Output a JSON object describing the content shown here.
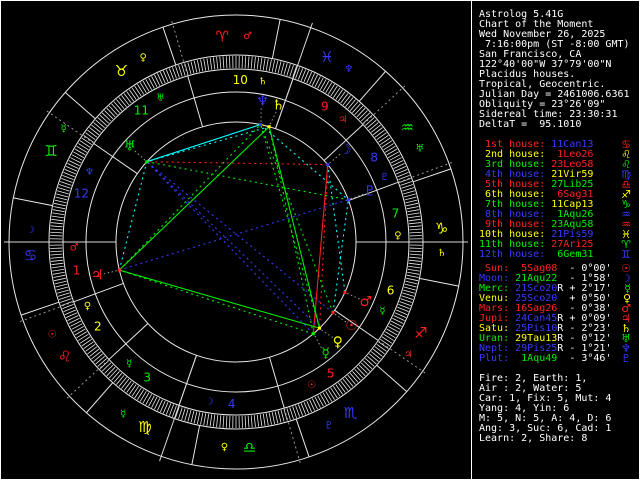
{
  "app": {
    "title_lines": [
      "Astrolog 5.41G",
      "Chart of the Moment",
      "Wed November 26, 2025",
      " 7:16:00pm (ST -8:00 GMT)",
      "San Francisco, CA",
      "122°40'00\"W 37°79'00\"N",
      "Placidus houses.",
      "Tropical, Geocentric.",
      "Julian Day = 2461006.6361",
      "Obliquity = 23°26'09\"",
      "Sidereal time: 23:30:31",
      "DeltaT =  95.1010"
    ]
  },
  "houses": [
    {
      "label": " 1st house:",
      "value": "11Can13",
      "sign": "Can"
    },
    {
      "label": " 2nd house:",
      "value": " 1Leo26",
      "sign": "Leo"
    },
    {
      "label": " 3rd house:",
      "value": "23Leo58",
      "sign": "Leo"
    },
    {
      "label": " 4th house:",
      "value": "21Vir59",
      "sign": "Vir"
    },
    {
      "label": " 5th house:",
      "value": "27Lib25",
      "sign": "Lib"
    },
    {
      "label": " 6th house:",
      "value": " 6Sag31",
      "sign": "Sag"
    },
    {
      "label": " 7th house:",
      "value": "11Cap13",
      "sign": "Cap"
    },
    {
      "label": " 8th house:",
      "value": " 1Aqu26",
      "sign": "Aqu"
    },
    {
      "label": " 9th house:",
      "value": "23Aqu58",
      "sign": "Aqu"
    },
    {
      "label": "10th house:",
      "value": "21Pis59",
      "sign": "Pis"
    },
    {
      "label": "11th house:",
      "value": "27Ari25",
      "sign": "Ari"
    },
    {
      "label": "12th house:",
      "value": " 6Gem31",
      "sign": "Gem"
    }
  ],
  "planets": [
    {
      "name": "Sun",
      "label": " Sun:",
      "value": " 5Sag08",
      "sign": "Sag",
      "retro": " ",
      "delta": "- 0°00'",
      "lon": 245.133
    },
    {
      "name": "Moon",
      "label": "Moon:",
      "value": "21Aqu22",
      "sign": "Aqu",
      "retro": " ",
      "delta": "- 1°58'",
      "lon": 321.367
    },
    {
      "name": "Mercury",
      "label": "Merc:",
      "value": "21Sco20",
      "sign": "Sco",
      "retro": "R",
      "delta": "+ 2°17'",
      "lon": 231.333
    },
    {
      "name": "Venus",
      "label": "Venu:",
      "value": "25Sco20",
      "sign": "Sco",
      "retro": " ",
      "delta": "+ 0°50'",
      "lon": 235.333
    },
    {
      "name": "Mars",
      "label": "Mars:",
      "value": "16Sag26",
      "sign": "Sag",
      "retro": " ",
      "delta": "- 0°38'",
      "lon": 256.433
    },
    {
      "name": "Jupiter",
      "label": "Jupi:",
      "value": "24Can45",
      "sign": "Can",
      "retro": "R",
      "delta": "+ 0°09'",
      "lon": 114.75
    },
    {
      "name": "Saturn",
      "label": "Satu:",
      "value": "25Pis10",
      "sign": "Pis",
      "retro": "R",
      "delta": "- 2°23'",
      "lon": 355.167
    },
    {
      "name": "Uranus",
      "label": "Uran:",
      "value": "29Tau13",
      "sign": "Tau",
      "retro": "R",
      "delta": "- 0°12'",
      "lon": 59.217
    },
    {
      "name": "Neptune",
      "label": "Nept:",
      "value": "29Pis25",
      "sign": "Pis",
      "retro": "R",
      "delta": "- 1°21'",
      "lon": 359.417
    },
    {
      "name": "Pluto",
      "label": "Plut:",
      "value": " 1Aqu49",
      "sign": "Aqu",
      "retro": " ",
      "delta": "- 3°46'",
      "lon": 301.817
    }
  ],
  "summary_lines": [
    "Fire: 2, Earth: 1,",
    "Air : 2, Water: 5",
    "Car: 1, Fix: 5, Mut: 4",
    "Yang: 4, Yin: 6",
    "M: 5, N: 5, A: 4, D: 6",
    "Ang: 3, Suc: 6, Cad: 1",
    "Learn: 2, Share: 8"
  ],
  "wheel": {
    "asc": 101.217,
    "cusps": [
      101.217,
      121.433,
      143.967,
      171.983,
      207.417,
      246.517,
      281.217,
      301.433,
      323.967,
      351.983,
      27.417,
      66.517
    ],
    "sign_order": [
      "Ari",
      "Tau",
      "Gem",
      "Can",
      "Leo",
      "Vir",
      "Lib",
      "Sco",
      "Sag",
      "Cap",
      "Aqu",
      "Pis"
    ],
    "house_rulers": [
      "Mars",
      "Venus",
      "Mercury",
      "Moon",
      "Sun",
      "Mercury",
      "Venus",
      "Pluto",
      "Jupiter",
      "Saturn",
      "Uranus",
      "Neptune"
    ]
  },
  "glyphs": {
    "Ari": "♈",
    "Tau": "♉",
    "Gem": "♊",
    "Can": "♋",
    "Leo": "♌",
    "Vir": "♍",
    "Lib": "♎",
    "Sco": "♏",
    "Sag": "♐",
    "Cap": "♑",
    "Aqu": "♒",
    "Pis": "♓",
    "Sun": "☉",
    "Moon": "☽",
    "Mercury": "☿",
    "Venus": "♀",
    "Mars": "♂",
    "Jupiter": "♃",
    "Saturn": "♄",
    "Uranus": "♅",
    "Neptune": "♆",
    "Pluto": "♇"
  },
  "colors": {
    "red": "#ff2020",
    "yellow": "#ffff00",
    "green": "#00ee00",
    "blue": "#3838ff",
    "cyan": "#00ffff",
    "white": "#ffffff",
    "grey": "#989898",
    "line": "#e8e8e8"
  },
  "element_of_sign": {
    "Ari": "red",
    "Tau": "yellow",
    "Gem": "green",
    "Can": "blue",
    "Leo": "red",
    "Vir": "yellow",
    "Lib": "green",
    "Sco": "blue",
    "Sag": "red",
    "Cap": "yellow",
    "Aqu": "green",
    "Pis": "blue"
  },
  "planet_colors": {
    "Sun": "red",
    "Moon": "blue",
    "Mercury": "green",
    "Venus": "yellow",
    "Mars": "red",
    "Jupiter": "red",
    "Saturn": "yellow",
    "Uranus": "green",
    "Neptune": "blue",
    "Pluto": "blue"
  },
  "ruler_of_sign": {
    "Ari": "Mars",
    "Tau": "Venus",
    "Gem": "Mercury",
    "Can": "Moon",
    "Leo": "Sun",
    "Vir": "Mercury",
    "Lib": "Venus",
    "Sco": "Pluto",
    "Sag": "Jupiter",
    "Cap": "Saturn",
    "Aqu": "Uranus",
    "Pis": "Neptune"
  },
  "aspects": [
    {
      "angle": 0,
      "orb": 8,
      "color": "yellow"
    },
    {
      "angle": 60,
      "orb": 6,
      "color": "cyan"
    },
    {
      "angle": 90,
      "orb": 8,
      "color": "red"
    },
    {
      "angle": 120,
      "orb": 8,
      "color": "green"
    },
    {
      "angle": 180,
      "orb": 8,
      "color": "blue"
    }
  ]
}
